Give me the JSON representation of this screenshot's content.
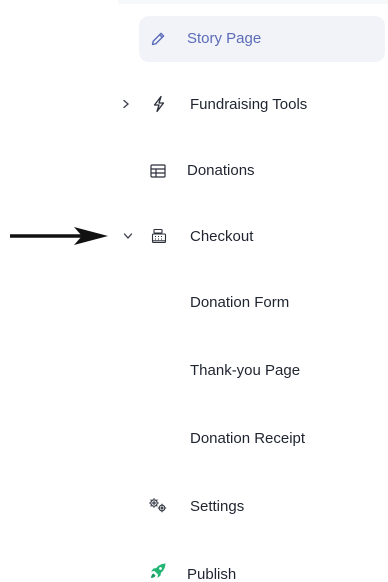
{
  "nav": {
    "story_page": {
      "label": "Story Page",
      "icon": "pencil-icon"
    },
    "fundraising_tools": {
      "label": "Fundraising Tools",
      "icon": "lightning-icon",
      "expander": "chevron-right-icon"
    },
    "donations": {
      "label": "Donations",
      "icon": "table-icon"
    },
    "checkout": {
      "label": "Checkout",
      "icon": "cash-register-icon",
      "expander": "chevron-down-icon",
      "children": [
        {
          "label": "Donation Form"
        },
        {
          "label": "Thank-you Page"
        },
        {
          "label": "Donation Receipt"
        }
      ]
    },
    "settings": {
      "label": "Settings",
      "icon": "gears-icon"
    },
    "publish": {
      "label": "Publish",
      "icon": "rocket-icon"
    }
  },
  "colors": {
    "active_bg": "#f1f3f9",
    "active_text": "#5b6cb8",
    "text": "#1f2430",
    "publish_icon": "#22b573"
  }
}
